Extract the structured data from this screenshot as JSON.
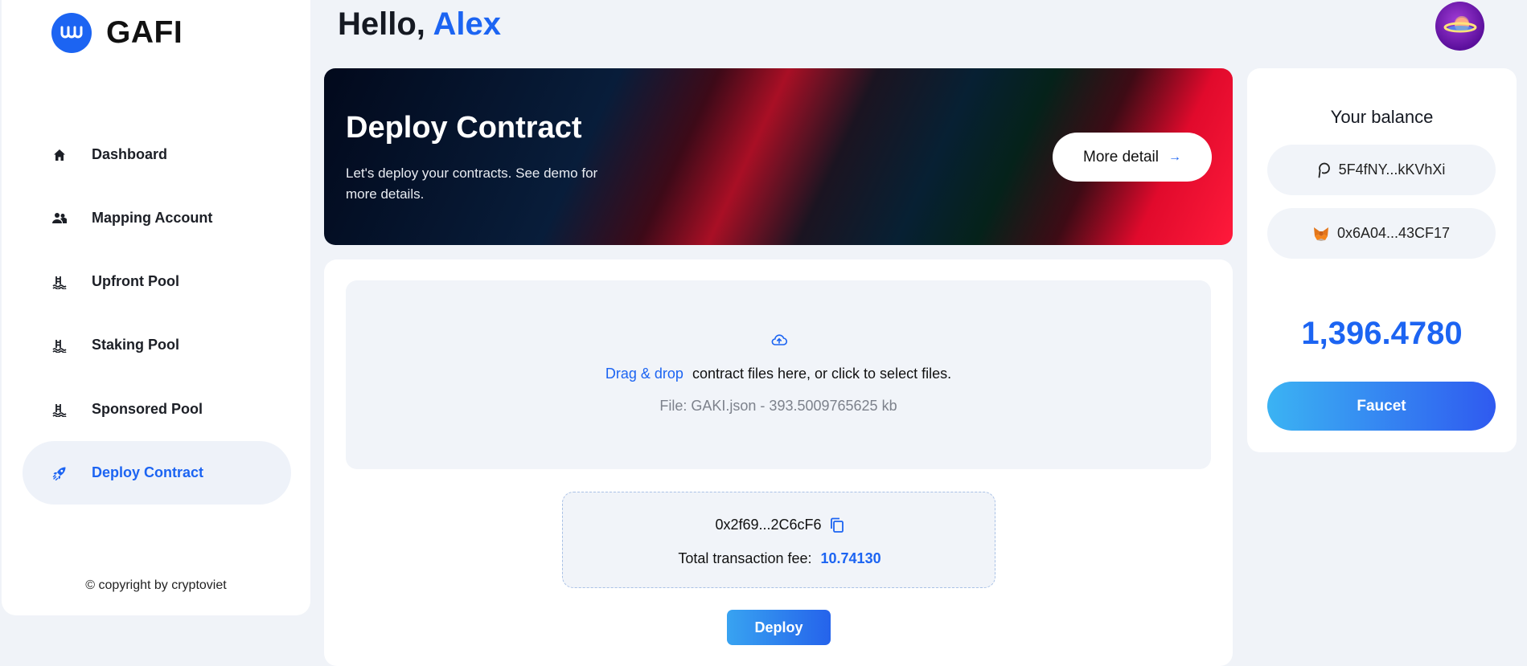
{
  "brand": {
    "name": "GAFI",
    "logo_icon": "gafi-logo-icon"
  },
  "sidebar": {
    "items": [
      {
        "label": "Dashboard",
        "icon": "home-icon"
      },
      {
        "label": "Mapping Account",
        "icon": "people-icon"
      },
      {
        "label": "Upfront Pool",
        "icon": "pool-icon"
      },
      {
        "label": "Staking Pool",
        "icon": "pool-icon"
      },
      {
        "label": "Sponsored Pool",
        "icon": "pool-icon"
      },
      {
        "label": "Deploy Contract",
        "icon": "rocket-icon",
        "active": true
      }
    ],
    "copyright": "© copyright by cryptoviet"
  },
  "header": {
    "greeting": "Hello,",
    "user_name": "Alex"
  },
  "banner": {
    "title": "Deploy Contract",
    "description": "Let's deploy your contracts. See demo for more details.",
    "button_label": "More detail",
    "button_arrow": "→"
  },
  "upload": {
    "link_text": "Drag & drop",
    "instruction": "contract files here, or click to select files.",
    "file_info": "File: GAKI.json - 393.5009765625 kb"
  },
  "transaction": {
    "address": "0x2f69...2C6cF6",
    "fee_label": "Total transaction fee:",
    "fee_value": "10.74130"
  },
  "deploy_button": "Deploy",
  "balance": {
    "title": "Your balance",
    "polkadot_address": "5F4fNY...kKVhXi",
    "metamask_address": "0x6A04...43CF17",
    "amount": "1,396.4780",
    "faucet_label": "Faucet"
  },
  "colors": {
    "accent": "#1c64f2",
    "sidebar_active_bg": "#eef2f9",
    "page_bg": "#f0f3f8"
  }
}
